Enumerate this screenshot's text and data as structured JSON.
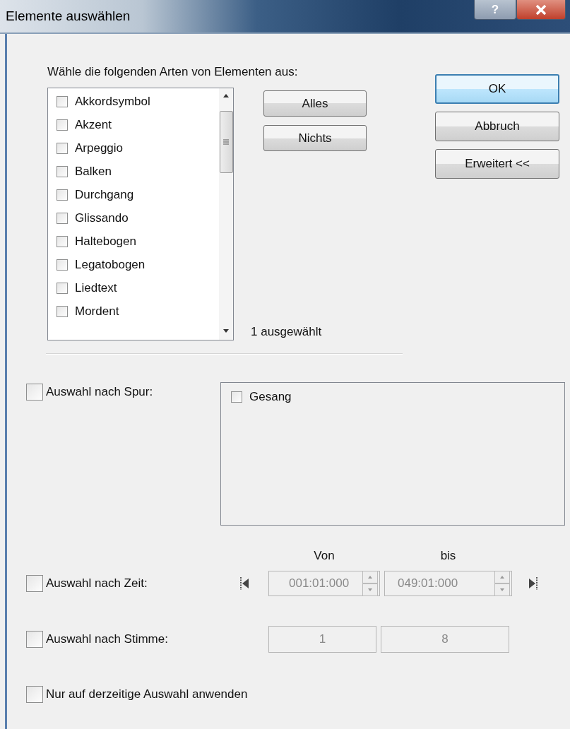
{
  "window": {
    "title": "Elemente auswählen",
    "help": "?"
  },
  "element_types": {
    "heading": "Wähle die folgenden Arten von Elementen aus:",
    "items": [
      {
        "label": "Akkordsymbol",
        "checked": false
      },
      {
        "label": "Akzent",
        "checked": false
      },
      {
        "label": "Arpeggio",
        "checked": false
      },
      {
        "label": "Balken",
        "checked": false
      },
      {
        "label": "Durchgang",
        "checked": false
      },
      {
        "label": "Glissando",
        "checked": false
      },
      {
        "label": "Haltebogen",
        "checked": false
      },
      {
        "label": "Legatobogen",
        "checked": false
      },
      {
        "label": "Liedtext",
        "checked": false
      },
      {
        "label": "Mordent",
        "checked": false
      }
    ],
    "list_buttons": [
      "Alles",
      "Nichts"
    ],
    "count": "1 ausgewählt"
  },
  "dialog_buttons": [
    {
      "label": "OK",
      "default": true
    },
    {
      "label": "Abbruch",
      "default": false
    },
    {
      "label": "Erweitert <<",
      "default": false
    }
  ],
  "by_track": {
    "label": "Auswahl nach Spur:",
    "checked": false,
    "tracks": [
      {
        "label": "Gesang",
        "checked": false
      }
    ]
  },
  "by_time": {
    "label": "Auswahl nach Zeit:",
    "checked": false,
    "disabled": true,
    "from_label": "Von",
    "to_label": "bis",
    "from": "001:01:000",
    "to": "049:01:000"
  },
  "by_voice": {
    "label": "Auswahl nach Stimme:",
    "checked": false,
    "disabled": true,
    "from": "1",
    "to": "8"
  },
  "current_only": {
    "label": "Nur auf derzeitige Auswahl anwenden",
    "checked": false
  }
}
